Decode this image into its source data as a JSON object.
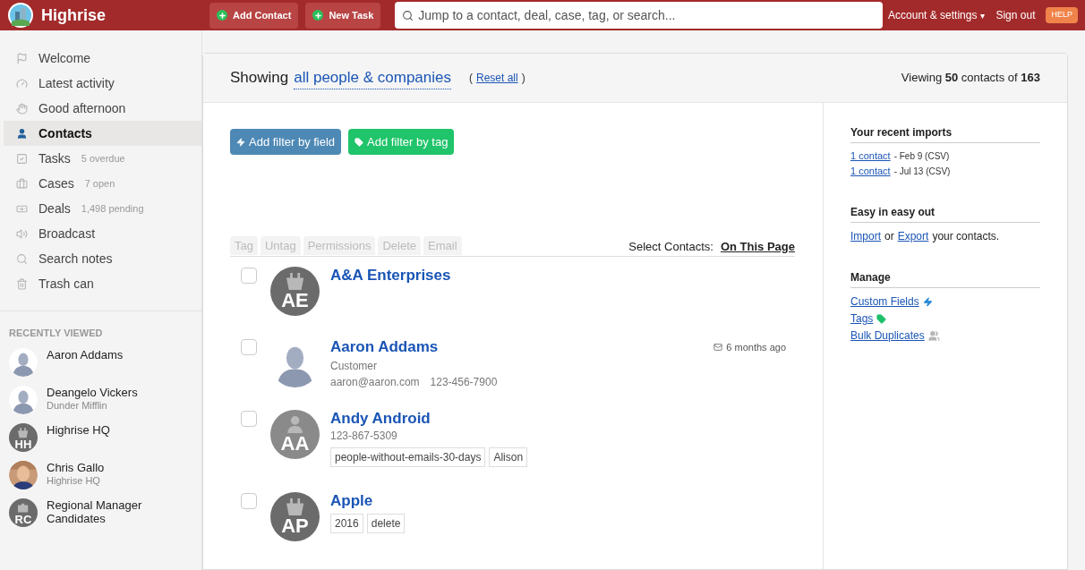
{
  "header": {
    "app_name": "Highrise",
    "buttons": [
      "Add Contact",
      "New Task"
    ],
    "search": {
      "placeholder": "Jump to a contact, deal, case, tag, or search..."
    },
    "account": "Account & settings",
    "account_caret": "▾",
    "sign_out": "Sign out",
    "help": "HELP"
  },
  "sidebar": {
    "items": [
      {
        "label": "Welcome",
        "selected": false
      },
      {
        "label": "Latest activity",
        "selected": false
      },
      {
        "label": "Good afternoon",
        "selected": false
      },
      {
        "label": "Contacts",
        "selected": true
      },
      {
        "label": "Tasks",
        "note": "5 overdue",
        "selected": false
      },
      {
        "label": "Cases",
        "note": "7 open",
        "selected": false
      },
      {
        "label": "Deals",
        "note": "1,498 pending",
        "selected": false
      },
      {
        "label": "Broadcast",
        "selected": false
      },
      {
        "label": "Search notes",
        "selected": false
      },
      {
        "label": "Trash can",
        "selected": false
      }
    ],
    "recent_title": "RECENTLY VIEWED",
    "recent": [
      {
        "name": "Aaron Addams",
        "kind": "silhouette"
      },
      {
        "name": "Deangelo Vickers",
        "sub": "Dunder Mifflin",
        "kind": "silhouette"
      },
      {
        "name": "Highrise HQ",
        "kind": "company",
        "initials": "HH"
      },
      {
        "name": "Chris Gallo",
        "sub": "Highrise HQ"
      },
      {
        "name": "Regional Manager Candidates",
        "kind": "case",
        "initials": "RC"
      }
    ]
  },
  "main": {
    "showing_label": "Showing",
    "showing_link": "all people & companies",
    "reset_open": "(",
    "reset": "Reset all",
    "reset_close": ")",
    "viewing": "Viewing **50** contacts of **163**",
    "filter_buttons": [
      {
        "label": "Add filter by field",
        "kind": "field"
      },
      {
        "label": "Add filter by tag",
        "kind": "tag"
      }
    ],
    "actions": [
      {
        "label": "Tag",
        "disabled": true
      },
      {
        "label": "Untag",
        "disabled": true
      },
      {
        "label": "Permissions",
        "disabled": true
      },
      {
        "label": "Delete",
        "disabled": true
      },
      {
        "label": "Email",
        "disabled": true
      }
    ],
    "select_label": "Select Contacts:",
    "select_link": "On This Page",
    "contacts": [
      {
        "name": "A&A Enterprises",
        "kind": "company",
        "initials": "AE",
        "checked": false
      },
      {
        "name": "Aaron Addams",
        "kind": "silhouette",
        "checked": false,
        "subtitle": "Customer",
        "email": "aaron@aaron.com",
        "phone": "123-456-7900",
        "last_contact": "6 months ago"
      },
      {
        "name": "Andy Android",
        "kind": "person",
        "initials": "AA",
        "checked": false,
        "phone": "123-867-5309",
        "tags": [
          "people-without-emails-30-days",
          "Alison"
        ]
      },
      {
        "name": "Apple",
        "kind": "company",
        "initials": "AP",
        "checked": false,
        "tags": [
          "2016",
          "delete"
        ]
      }
    ]
  },
  "aside": {
    "sections": [
      {
        "title": "Your recent imports",
        "lines": [
          {
            "link": "1 contact",
            "rest": "- Feb 9 (CSV)"
          },
          {
            "link": "1 contact",
            "rest": "- Jul 13 (CSV)"
          }
        ]
      },
      {
        "title": "Easy in easy out",
        "text_parts": [
          {
            "link": "Import"
          },
          {
            "text": "or"
          },
          {
            "link": "Export"
          },
          {
            "text": "your contacts."
          }
        ]
      },
      {
        "title": "Manage",
        "links": [
          {
            "label": "Custom Fields",
            "kind": "bolt"
          },
          {
            "label": "Tags",
            "kind": "tag"
          },
          {
            "label": "Bulk Duplicates",
            "kind": "people"
          }
        ]
      }
    ]
  }
}
